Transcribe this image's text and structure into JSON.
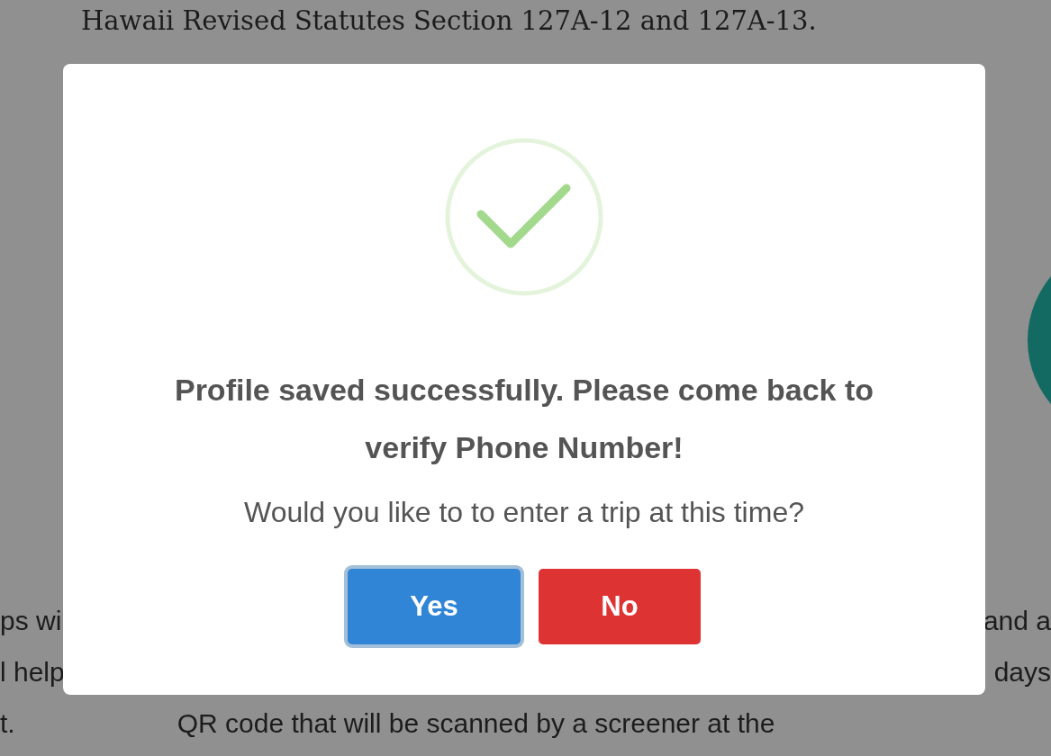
{
  "page": {
    "heading": "Hawaii Revised Statutes Section 127A-12 and 127A-13.",
    "text_rows": [
      {
        "left": "ps wi",
        "right": "and a"
      },
      {
        "left": "l help",
        "right": "days"
      },
      {
        "left": "t.",
        "center": "QR code that will be scanned by a screener at the"
      }
    ]
  },
  "dialog": {
    "title": "Profile saved successfully. Please come back to verify Phone Number!",
    "message": "Would you like to to enter a trip at this time?",
    "buttons": [
      {
        "label": "Yes",
        "kind": "confirm",
        "focused": true
      },
      {
        "label": "No",
        "kind": "cancel",
        "focused": false
      }
    ]
  }
}
